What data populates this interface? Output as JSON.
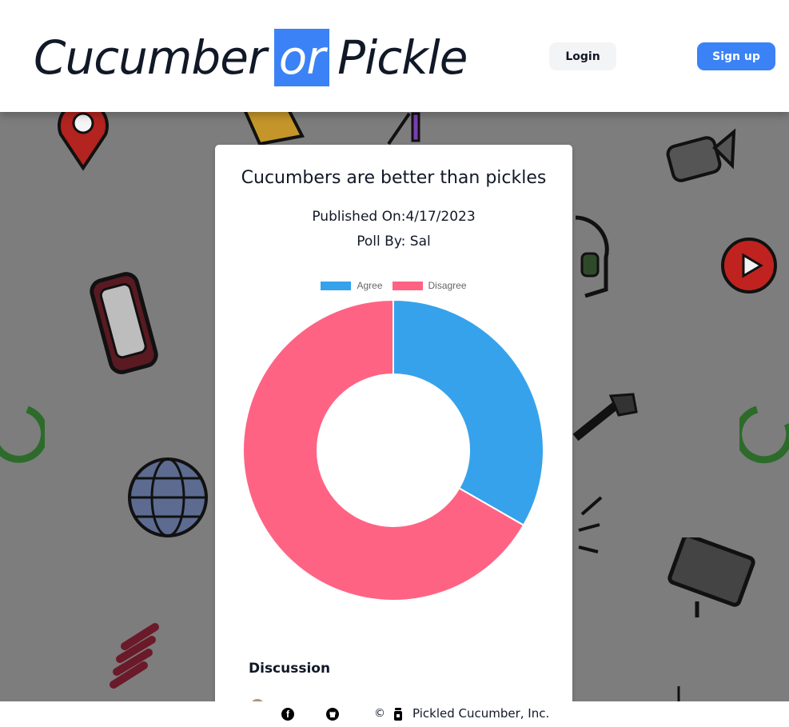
{
  "header": {
    "logo_left": "Cucumber",
    "logo_mid": "or",
    "logo_right": "Pickle",
    "login_label": "Login",
    "signup_label": "Sign up"
  },
  "poll": {
    "title": "Cucumbers are better than pickles",
    "published": "Published On:4/17/2023",
    "author": "Poll By: Sal",
    "discussion_label": "Discussion"
  },
  "chart_data": {
    "type": "pie",
    "variant": "doughnut",
    "categories": [
      "Agree",
      "Disagree"
    ],
    "values": [
      33.3,
      66.7
    ],
    "colors": [
      "#36a2eb",
      "#ff6384"
    ],
    "legend": "top"
  },
  "footer": {
    "copyright_symbol": "©",
    "company": "Pickled Cucumber, Inc.",
    "icons": [
      "facebook-icon",
      "github-icon",
      "jar-icon"
    ]
  },
  "colors": {
    "accent": "#3b82f6",
    "agree": "#36a2eb",
    "disagree": "#ff6384",
    "backdrop": "#7d7d7d"
  }
}
